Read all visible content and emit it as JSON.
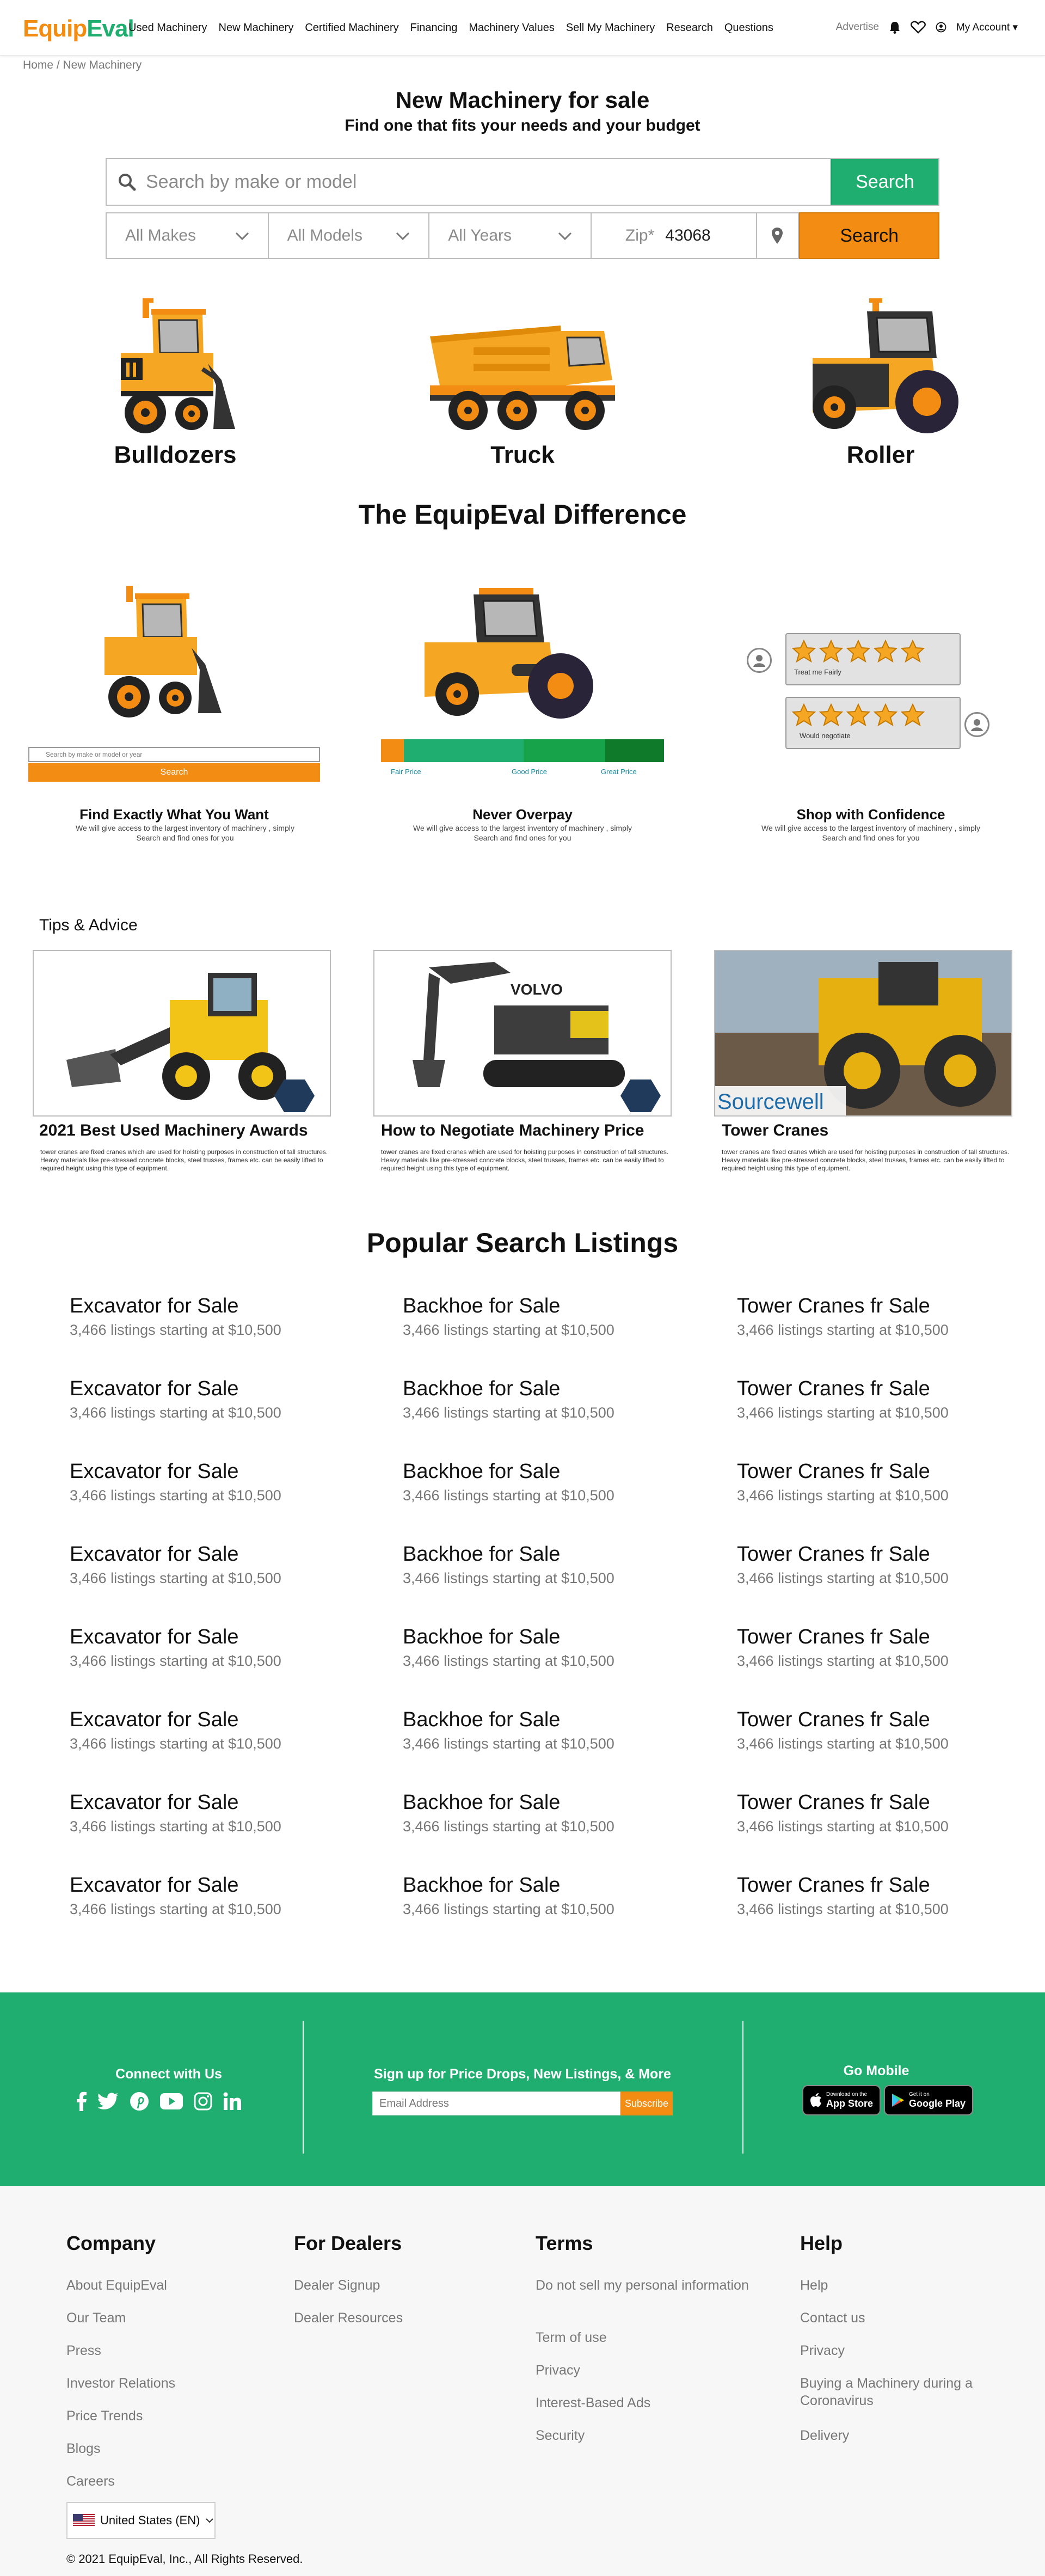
{
  "header": {
    "logo_a": "Equip",
    "logo_b": "Eval",
    "nav": [
      "Used Machinery",
      "New Machinery",
      "Certified Machinery",
      "Financing",
      "Machinery Values",
      "Sell My Machinery",
      "Research",
      "Questions"
    ],
    "advertise": "Advertise",
    "account": "My Account"
  },
  "breadcrumb": "Home / New Machinery",
  "hero": {
    "title": "New Machinery for sale",
    "subtitle": "Find one that fits your needs and your budget",
    "search_placeholder": "Search by make or model",
    "search_button": "Search",
    "filters": [
      "All Makes",
      "All Models",
      "All Years"
    ],
    "zip_label": "Zip*",
    "zip_value": "43068",
    "filter_button": "Search"
  },
  "categories": [
    "Bulldozers",
    "Truck",
    "Roller"
  ],
  "difference": {
    "title": "The EquipEval Difference",
    "mini_search_placeholder": "Search by make or model or year",
    "mini_search_button": "Search",
    "price_labels": [
      "Fair Price",
      "Good Price",
      "Great Price"
    ],
    "review1": "Treat me Fairly",
    "review2": "Would negotiate",
    "rating_stars": 5,
    "items": [
      {
        "title": "Find Exactly What You Want",
        "desc": "We will give access to the largest inventory of machinery , simply Search and find ones for you"
      },
      {
        "title": "Never Overpay",
        "desc": "We will give access to the largest inventory of machinery , simply Search and find ones for you"
      },
      {
        "title": "Shop with Confidence",
        "desc": "We will give access to the largest inventory of machinery , simply Search and find ones for you"
      }
    ]
  },
  "tips": {
    "heading": "Tips & Advice",
    "cards": [
      {
        "title": "2021 Best Used Machinery Awards",
        "desc": "tower cranes are fixed cranes which are used for hoisting purposes in construction of tall structures. Heavy materials like pre-stressed concrete blocks, steel trusses, frames etc. can be easily lifted to required height using this type of equipment."
      },
      {
        "title": "How to Negotiate Machinery Price",
        "desc": "tower cranes are fixed cranes which are used for hoisting purposes in construction of tall structures. Heavy materials like pre-stressed concrete blocks, steel trusses, frames etc. can be easily lifted to required height using this type of equipment.",
        "brand": "VOLVO"
      },
      {
        "title": "Tower Cranes",
        "desc": "tower cranes are fixed cranes which are used for hoisting purposes in construction of tall structures. Heavy materials like pre-stressed concrete blocks, steel trusses, frames etc. can be easily lifted to required height using this type of equipment.",
        "brand": "Sourcewell"
      }
    ]
  },
  "popular": {
    "title": "Popular Search Listings",
    "columns": [
      {
        "name": "Excavator for Sale",
        "sub": "3,466 listings starting at $10,500"
      },
      {
        "name": "Backhoe for Sale",
        "sub": "3,466 listings starting at $10,500"
      },
      {
        "name": "Tower Cranes fr Sale",
        "sub": "3,466 listings starting at $10,500"
      }
    ],
    "rows": 8
  },
  "band": {
    "connect": "Connect with Us",
    "signup": "Sign up for Price Drops, New Listings, & More",
    "email_placeholder": "Email Address",
    "subscribe": "Subscribe",
    "mobile": "Go Mobile",
    "appstore_small": "Download on the",
    "appstore_big": "App Store",
    "google_small": "Get it on",
    "google_big": "Google Play"
  },
  "footer": {
    "company": {
      "title": "Company",
      "links": [
        "About EquipEval",
        "Our Team",
        "Press",
        "Investor Relations",
        "Price Trends",
        "Blogs",
        "Careers"
      ]
    },
    "dealers": {
      "title": "For Dealers",
      "links": [
        "Dealer Signup",
        "Dealer Resources"
      ]
    },
    "terms": {
      "title": "Terms",
      "links": [
        "Do not sell my personal information",
        "Term of use",
        "Privacy",
        "Interest-Based Ads",
        "Security"
      ]
    },
    "help": {
      "title": "Help",
      "links": [
        "Help",
        "Contact us",
        "Privacy",
        "Buying a Machinery during a Coronavirus",
        "Delivery"
      ]
    },
    "country": "United States (EN)",
    "copyright": "© 2021 EquipEval, Inc., All Rights Reserved."
  },
  "colors": {
    "orange": "#f28c12",
    "green": "#1fae70"
  }
}
